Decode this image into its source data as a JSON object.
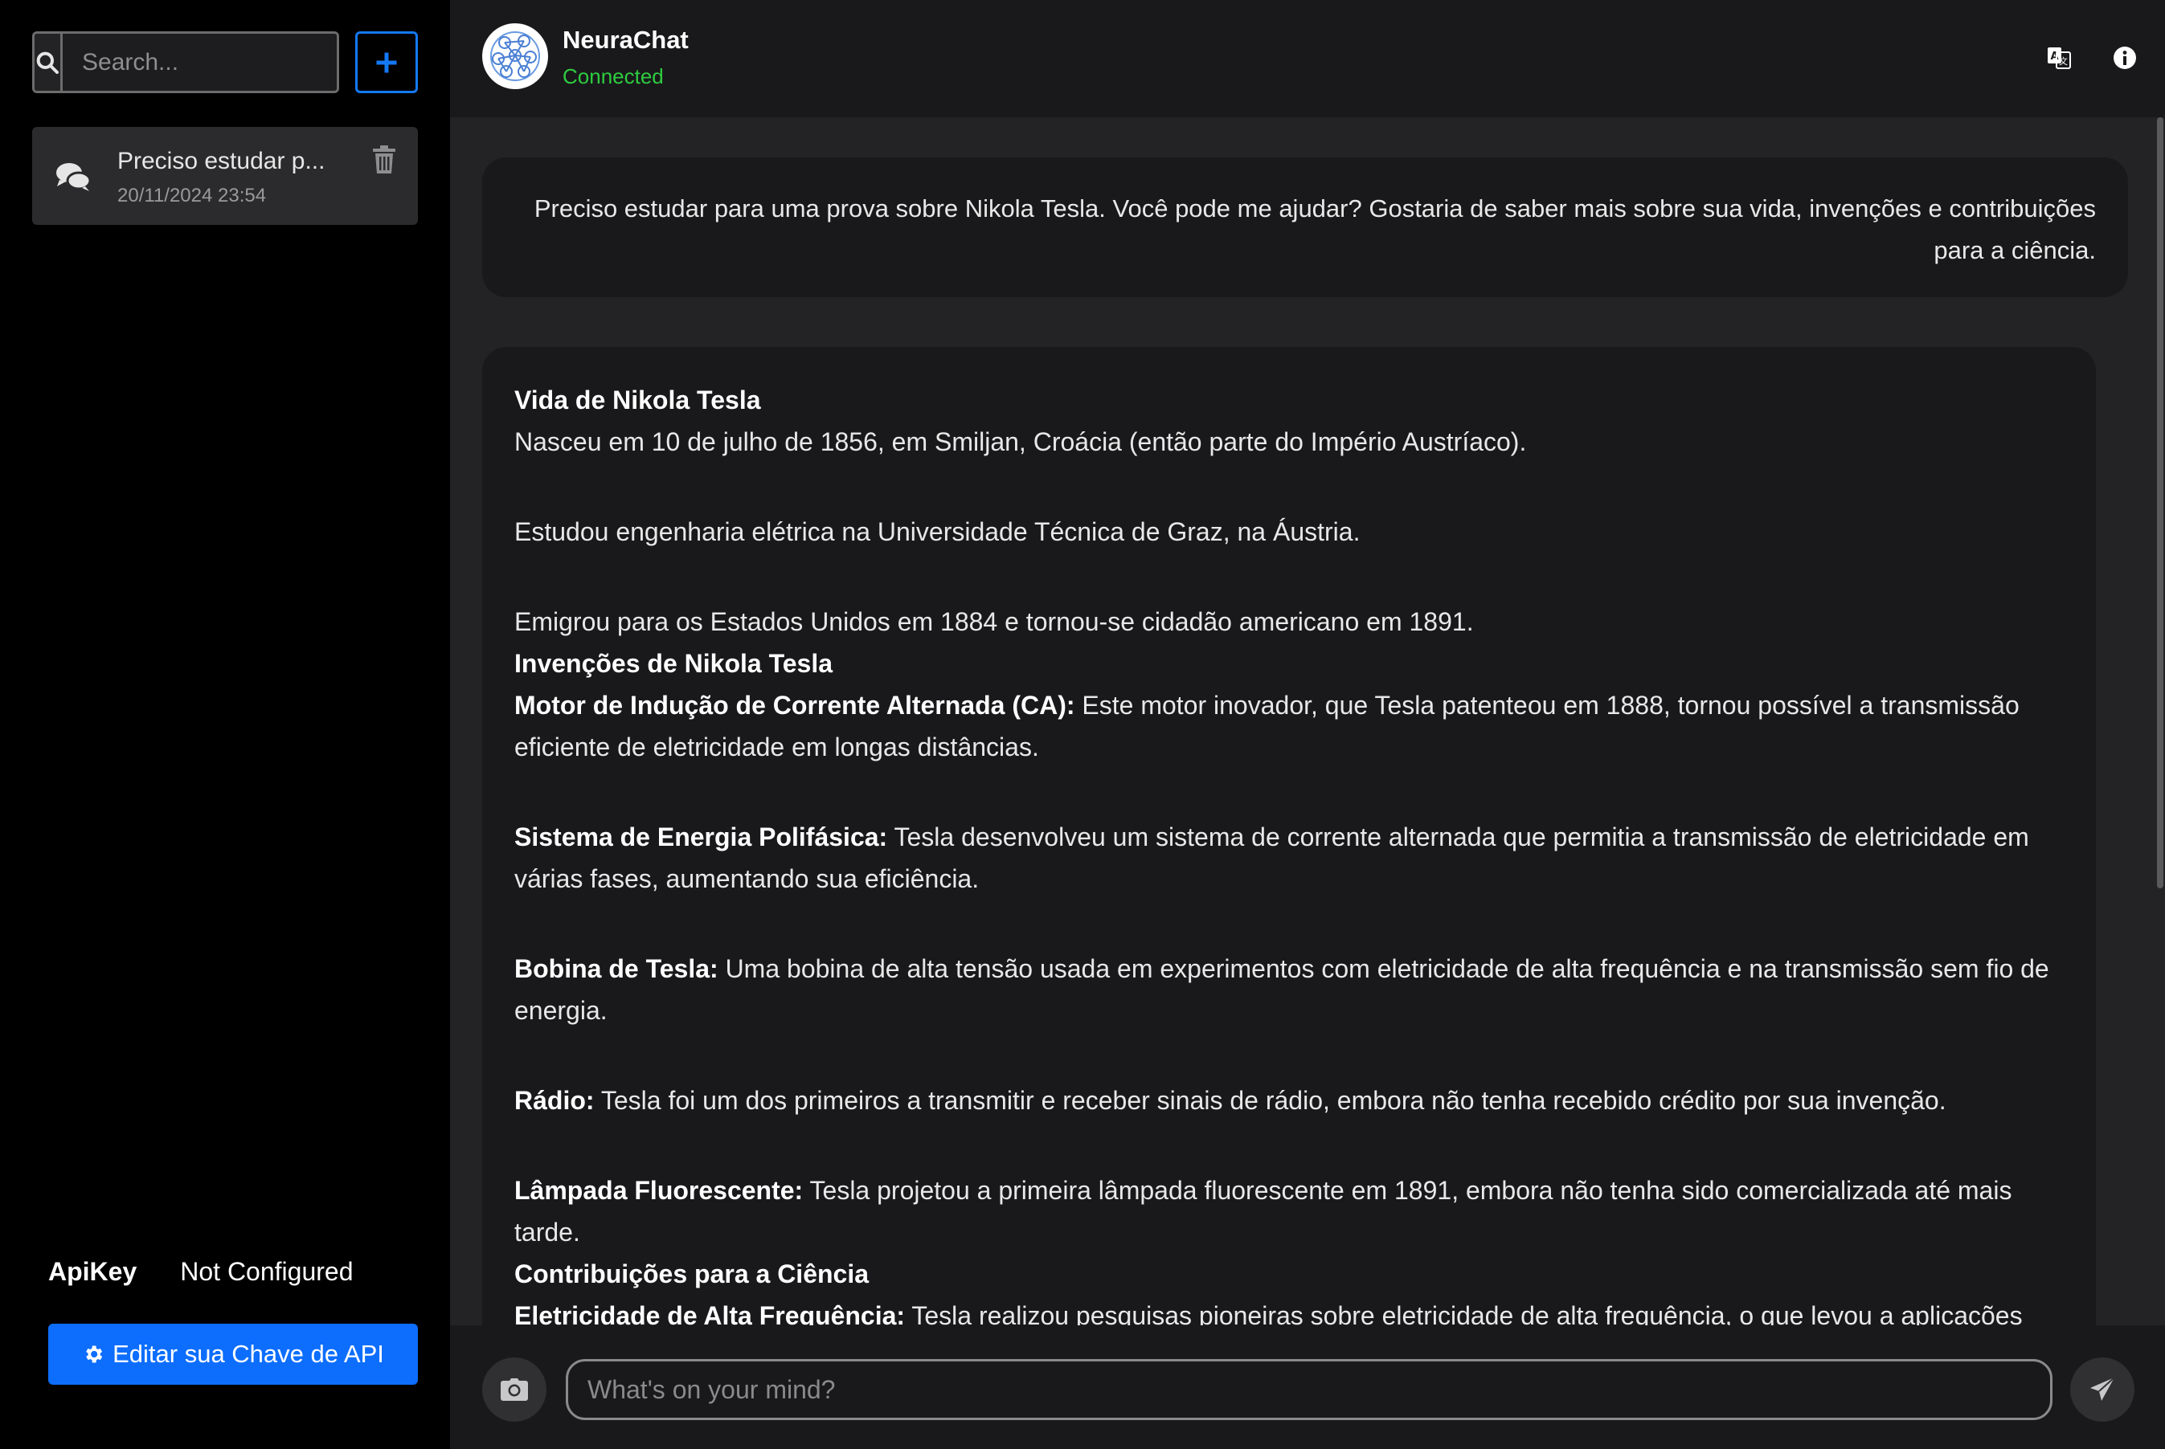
{
  "colors": {
    "accent": "#0d6efd",
    "status_connected": "#2ecc40",
    "sidebar_bg": "#000000",
    "main_bg": "#232325",
    "panel_bg": "#19191b"
  },
  "sidebar": {
    "search": {
      "placeholder": "Search...",
      "icon": "search-icon"
    },
    "new_chat": {
      "icon": "plus-icon"
    },
    "chats": [
      {
        "title": "Preciso estudar p...",
        "date": "20/11/2024 23:54",
        "icon": "comments-icon",
        "delete_icon": "trash-icon"
      }
    ],
    "api_key": {
      "label": "ApiKey",
      "status": "Not Configured",
      "edit_button": "Editar sua Chave de API",
      "edit_icon": "gear-icon"
    }
  },
  "header": {
    "title": "NeuraChat",
    "status": "Connected",
    "avatar_icon": "neural-network-icon",
    "actions": [
      "translate-icon",
      "info-icon"
    ]
  },
  "conversation": {
    "user_message": "Preciso estudar para uma prova sobre Nikola Tesla. Você pode me ajudar? Gostaria de saber mais sobre sua vida, invenções e contribuições para a ciência.",
    "bot_message": {
      "heading_life": "Vida de Nikola Tesla",
      "life_1": "Nasceu em 10 de julho de 1856, em Smiljan, Croácia (então parte do Império Austríaco).",
      "life_2": "Estudou engenharia elétrica na Universidade Técnica de Graz, na Áustria.",
      "life_3": "Emigrou para os Estados Unidos em 1884 e tornou-se cidadão americano em 1891.",
      "heading_inventions": "Invenções de Nikola Tesla",
      "inventions": [
        {
          "title": "Motor de Indução de Corrente Alternada (CA):",
          "text": " Este motor inovador, que Tesla patenteou em 1888, tornou possível a transmissão eficiente de eletricidade em longas distâncias."
        },
        {
          "title": "Sistema de Energia Polifásica:",
          "text": " Tesla desenvolveu um sistema de corrente alternada que permitia a transmissão de eletricidade em várias fases, aumentando sua eficiência."
        },
        {
          "title": "Bobina de Tesla:",
          "text": " Uma bobina de alta tensão usada em experimentos com eletricidade de alta frequência e na transmissão sem fio de energia."
        },
        {
          "title": "Rádio:",
          "text": " Tesla foi um dos primeiros a transmitir e receber sinais de rádio, embora não tenha recebido crédito por sua invenção."
        },
        {
          "title": "Lâmpada Fluorescente:",
          "text": " Tesla projetou a primeira lâmpada fluorescente em 1891, embora não tenha sido comercializada até mais tarde."
        }
      ],
      "heading_contributions": "Contribuições para a Ciência",
      "contributions": [
        {
          "title": "Eletricidade de Alta Frequência:",
          "text": " Tesla realizou pesquisas pioneiras sobre eletricidade de alta frequência, o que levou a aplicações em medicina, comunicação e indústria."
        }
      ]
    }
  },
  "composer": {
    "placeholder": "What's on your mind?",
    "camera_icon": "camera-icon",
    "send_icon": "send-icon"
  }
}
